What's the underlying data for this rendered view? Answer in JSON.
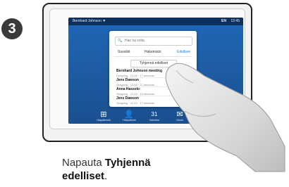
{
  "step_number": "3",
  "topbar": {
    "user": "Bernhard Johnson",
    "indicator": "▼",
    "right_1": "EN",
    "right_2": "12:45"
  },
  "panel": {
    "search_placeholder": "Hae tai soita",
    "tabs": [
      "Suosikit",
      "Hakemisto",
      "Edelliset"
    ],
    "clear_button": "Tyhjennä edelliset",
    "rows": [
      {
        "name": "Bernhard Johnson meeting",
        "detail": "Outgoing · 12:45 · 17 seconds"
      },
      {
        "name": "Jens Dawson",
        "detail": "Outgoing · 12:40 · 27 seconds"
      },
      {
        "name": "Anna Hasselo",
        "detail": "Outgoing · 12:15 · 10 seconds"
      },
      {
        "name": "Jens Dawson",
        "detail": "Outgoing · 12:10 · 17 seconds"
      }
    ]
  },
  "dock": [
    {
      "glyph": "⊞",
      "label": "Näppäimistö",
      "icon": "keypad-icon"
    },
    {
      "glyph": "👤",
      "label": "Yhteystiedot",
      "icon": "contacts-icon"
    },
    {
      "glyph": "31",
      "label": "Kalenteri",
      "icon": "calendar-icon"
    },
    {
      "glyph": "✉",
      "label": "Viestit",
      "icon": "messages-icon"
    },
    {
      "glyph": "⇪",
      "label": "Jaa",
      "icon": "share-icon"
    }
  ],
  "caption": {
    "prefix": "Napauta ",
    "bold_1": "Tyhjennä",
    "bold_2": "edelliset",
    "suffix": "."
  }
}
